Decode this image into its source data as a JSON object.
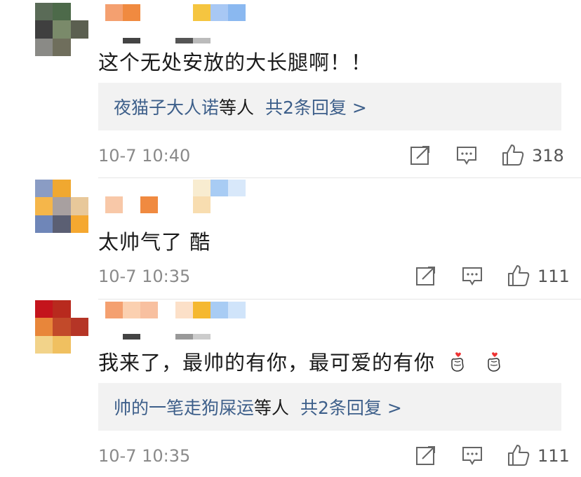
{
  "comments": [
    {
      "text": "这个无处安放的大长腿啊！！",
      "replies": {
        "names": "夜猫子大人诺",
        "suffix": "等人",
        "count_label": "共2条回复 >"
      },
      "time": "10-7 10:40",
      "likes": "318",
      "avatar_colors": [
        "#5a6b57",
        "#4d6a4a",
        "#6f8a68",
        "#3f3f3f",
        "#7a8a6a",
        "#5b5f50",
        "#8a8a86",
        "#6f6e5c",
        "#ffffff"
      ]
    },
    {
      "text": "太帅气了 酷",
      "time": "10-7 10:35",
      "likes": "111",
      "avatar_colors": [
        "#8a9cc4",
        "#f0a830",
        "#ffffff",
        "#f5b64a",
        "#a8a0a0",
        "#e8c89a",
        "#6f86b8",
        "#5b5f73",
        "#3a3a4a"
      ]
    },
    {
      "text": "我来了，最帅的有你，最可爱的有你",
      "replies": {
        "names": "帅的一笔走狗屎运",
        "suffix": "等人",
        "count_label": "共2条回复 >"
      },
      "time": "10-7 10:35",
      "likes": "111",
      "avatar_colors": [
        "#c4141c",
        "#b82a1e",
        "#ffffff",
        "#e8863a",
        "#c24a2a",
        "#b53526",
        "#f2d38a",
        "#f0c060",
        "#ffffff"
      ]
    }
  ],
  "icons": {
    "share": "share-icon",
    "comment": "comment-icon",
    "like": "thumbs-up-icon",
    "emoji": "finger-heart-emoji"
  }
}
